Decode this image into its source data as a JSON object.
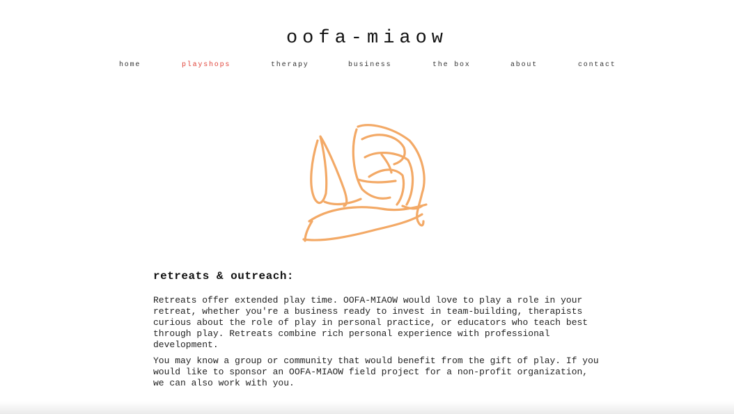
{
  "site": {
    "title": "oofa-miaow"
  },
  "nav": {
    "items": [
      {
        "label": "home"
      },
      {
        "label": "playshops"
      },
      {
        "label": "therapy"
      },
      {
        "label": "business"
      },
      {
        "label": "the box"
      },
      {
        "label": "about"
      },
      {
        "label": "contact"
      }
    ],
    "active_color": "#e0443a"
  },
  "illustration": {
    "icon": "orange-crayon-scribble",
    "color": "#f0a050"
  },
  "content": {
    "heading": "retreats & outreach:",
    "paragraphs": [
      "Retreats offer extended play time. OOFA-MIAOW would love to play a role in your retreat, whether you're a business ready to invest in team-building, therapists curious about the role of play in personal practice, or educators who teach best through play. Retreats combine rich personal experience with professional development.",
      "You may know a group or community that would benefit from the gift of play. If you would like to sponsor an OOFA-MIAOW field project for a non-profit organization, we can also work with you."
    ]
  }
}
